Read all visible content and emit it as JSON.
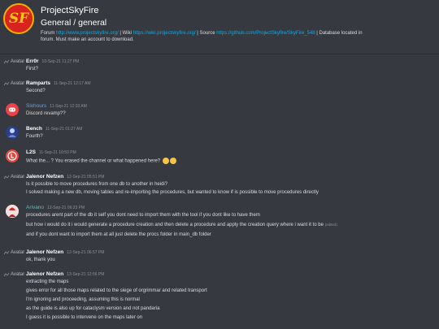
{
  "header": {
    "server_name": "ProjectSkyFire",
    "channel_path": "General / general",
    "topic": {
      "t1": "Forum ",
      "forum_link": "http://www.projectskyfire.org/",
      "t2": " | Wiki ",
      "wiki_link": "https://wiki.projectskyfire.org/",
      "t3": " | Source ",
      "source_link": "https://github.com/ProjectSkyfire/SkyFire_548",
      "t4": " | Database located in",
      "t5": "forum. Must make an account to download."
    },
    "icon_letters": "SF"
  },
  "avatar_alt": "Avatar",
  "messages": [
    {
      "author": "Err0r",
      "ts": "10-Sep-21 11:27 PM",
      "lines": [
        "First?"
      ]
    },
    {
      "author": "Ramparts",
      "ts": "11-Sep-21 12:17 AM",
      "lines": [
        "Second?"
      ]
    },
    {
      "author": "Sixhours",
      "ts": "11-Sep-21 12:33 AM",
      "lines": [
        "Discord revamp??"
      ]
    },
    {
      "author": "Bench",
      "ts": "11-Sep-21 01:27 AM",
      "lines": [
        "Fourth?"
      ]
    },
    {
      "author": "L2S",
      "ts": "11-Sep-21 10:50 PM",
      "lines": [
        "What the... ? You erased the channel or what happened here?"
      ]
    },
    {
      "author": "Jalenor Nefzen",
      "ts": "12-Sep-21 05:51 PM",
      "lines": [
        "Is it possible to move procedures from one db to another in heidi?",
        "I solved making a new db, moving tables and re-importing the procedures, but wanted to know if is possible to move procedures directly"
      ]
    },
    {
      "author": "Arivano",
      "ts": "12-Sep-21 06:23 PM",
      "lines": [
        "procedures arent part of the db it self you dont need to import them with the tool if you dont like to have them",
        "but how i would do it i would generate a procedure creation and then delete a procedure and apply the creation query where i want it to be",
        "and if you dont want to import them at all just delete the procs folder in main_db folder"
      ],
      "edited": "(edited)"
    },
    {
      "author": "Jalenor Nefzen",
      "ts": "12-Sep-21 06:57 PM",
      "lines": [
        "ok, thank you"
      ]
    },
    {
      "author": "Jalenor Nefzen",
      "ts": "13-Sep-21 12:56 PM",
      "lines": [
        "extracting the maps",
        "gives error for all those maps related to the siege of orgrimmar and related transport",
        "I'm ignoring and proceeding, assuming this is normal",
        "as the guide is also up for cataclysm version and not pandaria",
        "I guess it is possible to intervene on the maps later on"
      ]
    }
  ]
}
